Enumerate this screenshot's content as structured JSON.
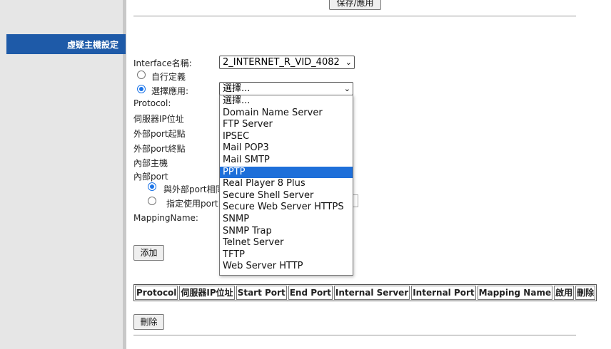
{
  "top": {
    "save_button": "保存/應用"
  },
  "sidebar": {
    "active_item": "虛疑主機設定"
  },
  "form": {
    "interface_label": "Interface名稱:",
    "interface_value": "2_INTERNET_R_VID_4082",
    "custom_label": "自行定義",
    "select_app_label": "選擇應用:",
    "select_app_value": "選擇...",
    "protocol_label": "Protocol:",
    "server_ip_label": "伺服器IP位址",
    "ext_port_start_label": "外部port起點",
    "ext_port_end_label": "外部port終點",
    "internal_host_label": "內部主機",
    "internal_port_label": "內部port",
    "same_as_external_label": "與外部port相同",
    "specify_port_label": "指定使用port",
    "mapping_name_label": "MappingName:",
    "add_button": "添加",
    "delete_button": "刪除"
  },
  "dropdown": {
    "selected_index": 6,
    "options": [
      "選擇...",
      "Domain Name Server",
      "FTP Server",
      "IPSEC",
      "Mail POP3",
      "Mail SMTP",
      "PPTP",
      "Real Player 8 Plus",
      "Secure Shell Server",
      "Secure Web Server HTTPS",
      "SNMP",
      "SNMP Trap",
      "Telnet Server",
      "TFTP",
      "Web Server HTTP"
    ]
  },
  "table": {
    "headers": [
      "Protocol",
      "伺服器IP位址",
      "Start Port",
      "End Port",
      "Internal Server",
      "Internal Port",
      "Mapping Name",
      "啟用",
      "刪除"
    ]
  },
  "colors": {
    "sidebar_active": "#1e5aa8",
    "highlight": "#1e6fd9",
    "radio_checked": "#1a73e8"
  }
}
